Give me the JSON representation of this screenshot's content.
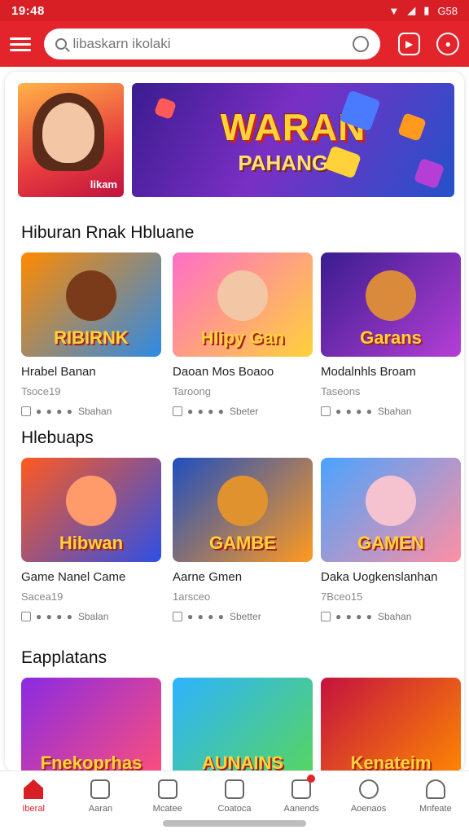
{
  "status_bar": {
    "time": "19:48",
    "battery": "G58"
  },
  "search": {
    "placeholder": "libaskarn ikolaki"
  },
  "banner": {
    "title": "WARAN",
    "subtitle": "PAHANGIS",
    "tile_label": "likam"
  },
  "sections": [
    {
      "title": "Hiburan Rnak Hbluane",
      "cards": [
        {
          "thumb_text": "RIBIRNK",
          "title": "Hrabel Banan",
          "subtitle": "Tsoce19",
          "meta": "Sbahan",
          "colors": [
            "#ff8a00",
            "#2e8ae6"
          ]
        },
        {
          "thumb_text": "Hlipy Gan",
          "title": "Daoan Mos Boaoo",
          "subtitle": "Taroong",
          "meta": "Sbeter",
          "colors": [
            "#ff6ec7",
            "#ffd23a"
          ]
        },
        {
          "thumb_text": "Garans",
          "title": "Modalnhls Broam",
          "subtitle": "Taseons",
          "meta": "Sbahan",
          "colors": [
            "#3a1c8f",
            "#b53fd6"
          ]
        }
      ]
    },
    {
      "title": "Hlebuaps",
      "cards": [
        {
          "thumb_text": "Hibwan",
          "title": "Game Nanel Came",
          "subtitle": "Sacea19",
          "meta": "Sbalan",
          "colors": [
            "#ff5a1f",
            "#2e4fe6"
          ]
        },
        {
          "thumb_text": "GAMBE",
          "title": "Aarne Gmen",
          "subtitle": "1arsceo",
          "meta": "Sbetter",
          "colors": [
            "#1f4fbf",
            "#ff9a1f"
          ]
        },
        {
          "thumb_text": "GAMEN",
          "title": "Daka Uogkenslanhan",
          "subtitle": "7Bceo15",
          "meta": "Sbahan",
          "colors": [
            "#4aa3ff",
            "#ff8fa3"
          ]
        }
      ]
    },
    {
      "title": "Eapplatans",
      "cards": [
        {
          "thumb_text": "Fnekoprhas",
          "colors": [
            "#8a2be2",
            "#ff4f7a"
          ]
        },
        {
          "thumb_text": "AUNAINS",
          "colors": [
            "#2db3ff",
            "#58d65b"
          ]
        },
        {
          "thumb_text": "Kenateim",
          "colors": [
            "#c4123f",
            "#ff8a00"
          ]
        }
      ]
    }
  ],
  "bottom_nav": [
    {
      "label": "Iberal",
      "icon": "home-icon",
      "active": true
    },
    {
      "label": "Aaran",
      "icon": "store-icon"
    },
    {
      "label": "Mcatee",
      "icon": "heart-icon"
    },
    {
      "label": "Coatoca",
      "icon": "checklist-icon"
    },
    {
      "label": "Aanends",
      "icon": "notification-icon",
      "badge": true
    },
    {
      "label": "Aoenaos",
      "icon": "search-icon"
    },
    {
      "label": "Mnfeate",
      "icon": "profile-icon"
    }
  ],
  "colors": {
    "brand": "#e3252b",
    "status_bar": "#d81f26"
  }
}
